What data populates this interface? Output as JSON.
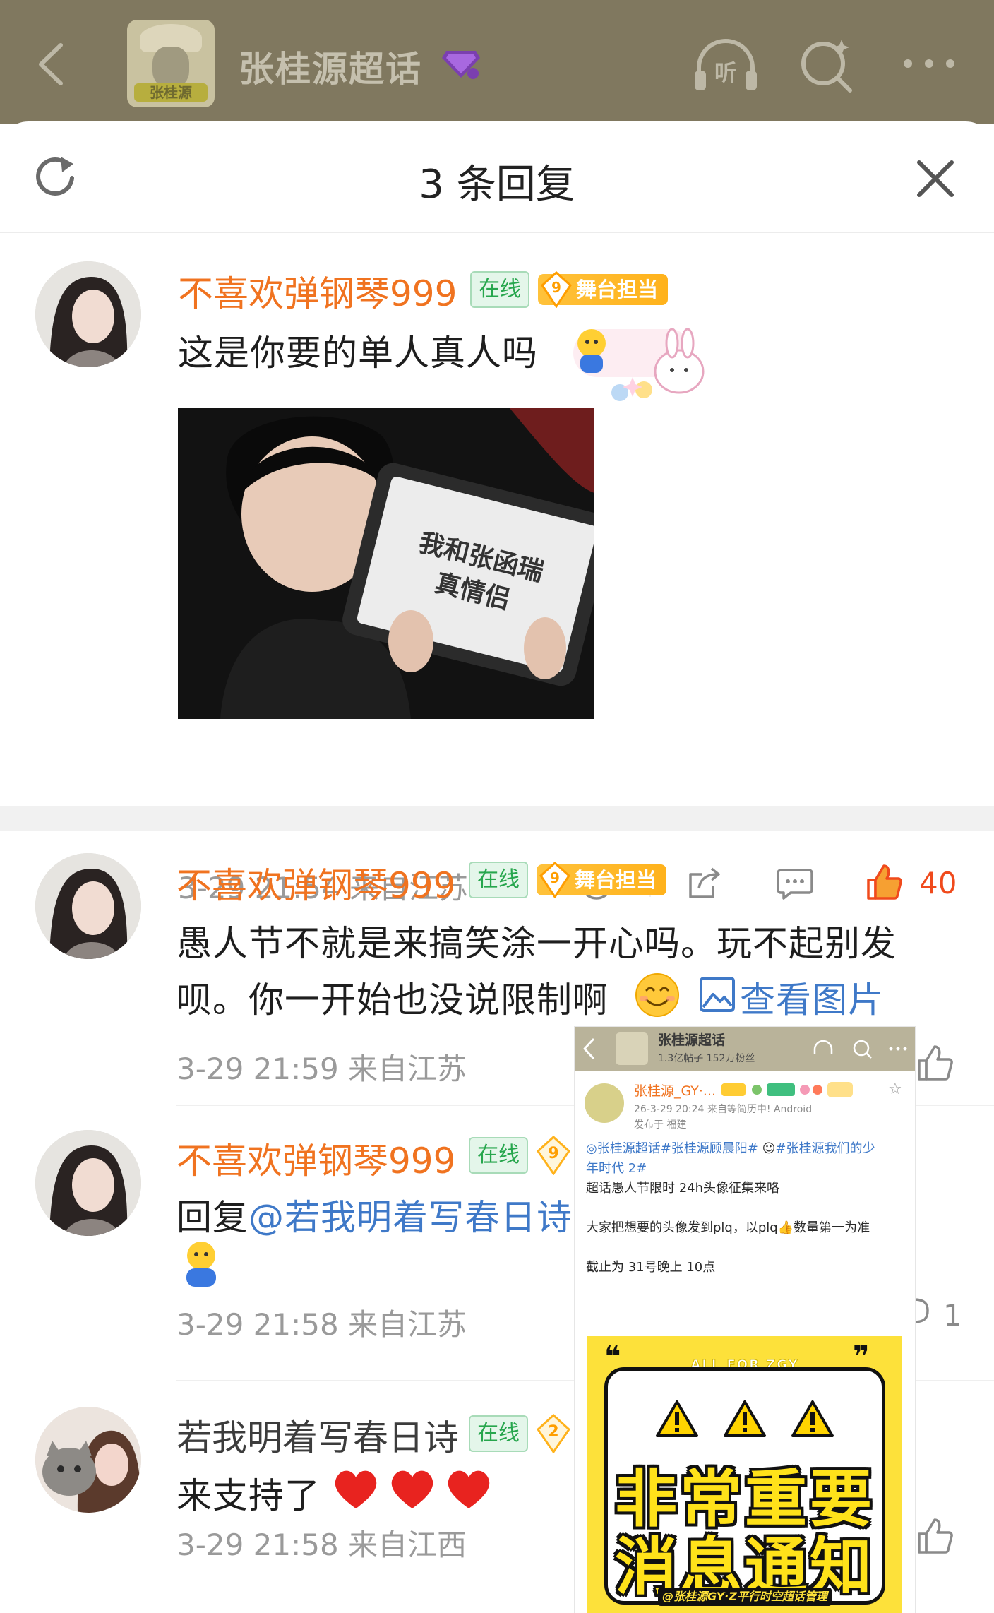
{
  "topbar": {
    "title": "张桂源超话",
    "cover_tag": "张桂源",
    "icons": [
      "back-icon",
      "supertopic-gem-icon",
      "listen-icon",
      "search-icon",
      "more-icon"
    ]
  },
  "sheet": {
    "title": "3 条回复",
    "icons": [
      "refresh-icon",
      "close-icon"
    ]
  },
  "comments": [
    {
      "username": "不喜欢弹钢琴999",
      "online": "在线",
      "level": "9",
      "badge": "舞台担当",
      "text": "这是你要的单人真人吗",
      "photo_text_line1": "我和张函瑞",
      "photo_text_line2": "真情侣",
      "meta": "3-29 21:54  来自江苏",
      "likes": "40"
    },
    {
      "username": "不喜欢弹钢琴999",
      "online": "在线",
      "level": "9",
      "badge": "舞台担当",
      "text_line1": "愚人节不就是来搞笑涂一开心吗。玩不起别发",
      "text_line2": "呗。你一开始也没说限制啊",
      "view_image": "查看图片",
      "meta": "3-29 21:59  来自江苏"
    },
    {
      "username": "不喜欢弹钢琴999",
      "online": "在线",
      "level": "9",
      "reply_prefix": "回复",
      "mention": "@若我明着写春日诗",
      "meta": "3-29 21:58  来自江苏",
      "reply_count": "1"
    },
    {
      "username": "若我明着写春日诗",
      "online": "在线",
      "level": "2",
      "text": "来支持了",
      "meta": "3-29 21:58  来自江西"
    }
  ],
  "preview": {
    "bar_title": "张桂源超话",
    "bar_stats": "1.3亿帖子 152万粉丝",
    "username": "张桂源_GY·...",
    "time": "26-3-29 20:24  来自等简历中! Android",
    "location": "发布于 福建",
    "topic_line1_prefix": "◎",
    "topic_line1": "张桂源超话#张桂源顾晨阳#",
    "topic_line1_tail": "#张桂源我们的少",
    "topic_line2": "年时代 2#",
    "line3": "超话愚人节限时 24h头像征集来咯",
    "line4": "大家把想要的头像发到plq，以plq",
    "line4_tail": "数量第一为准",
    "line5": "截止为 31号晚上 10点",
    "poster_header": "ALL FOR ZGY",
    "poster_line1": "非常重要",
    "poster_line2": "消息通知",
    "poster_footer": "@张桂源GY·Z平行时空超话管理组"
  },
  "colors": {
    "username": "#f07320",
    "link": "#3f79c8",
    "like": "#f04a1c",
    "online_text": "#27a64d",
    "badge": "#ffb21b",
    "meta": "#9a9a9a"
  }
}
